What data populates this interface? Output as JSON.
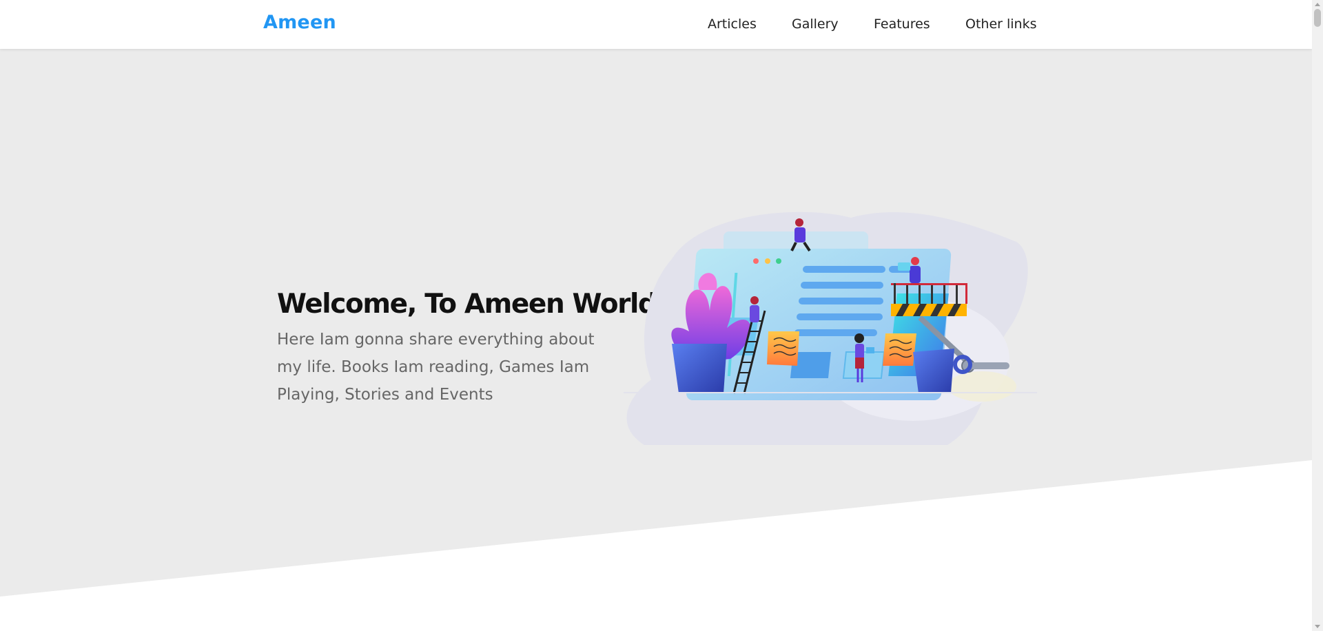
{
  "header": {
    "brand": "Ameen",
    "nav": [
      "Articles",
      "Gallery",
      "Features",
      "Other links"
    ]
  },
  "hero": {
    "title": "Welcome, To Ameen World",
    "description": "Here Iam gonna share everything about my life. Books Iam reading, Games Iam Playing, Stories and Events",
    "illustration_icon": "web-design-team-illustration",
    "scroll_icon": "double-chevron-down-icon"
  },
  "colors": {
    "accent": "#2196f3",
    "hero_background": "#ebebeb",
    "page_background": "#ffffff",
    "heading": "#111111",
    "body_text": "#666666",
    "nav_text": "#222222"
  }
}
